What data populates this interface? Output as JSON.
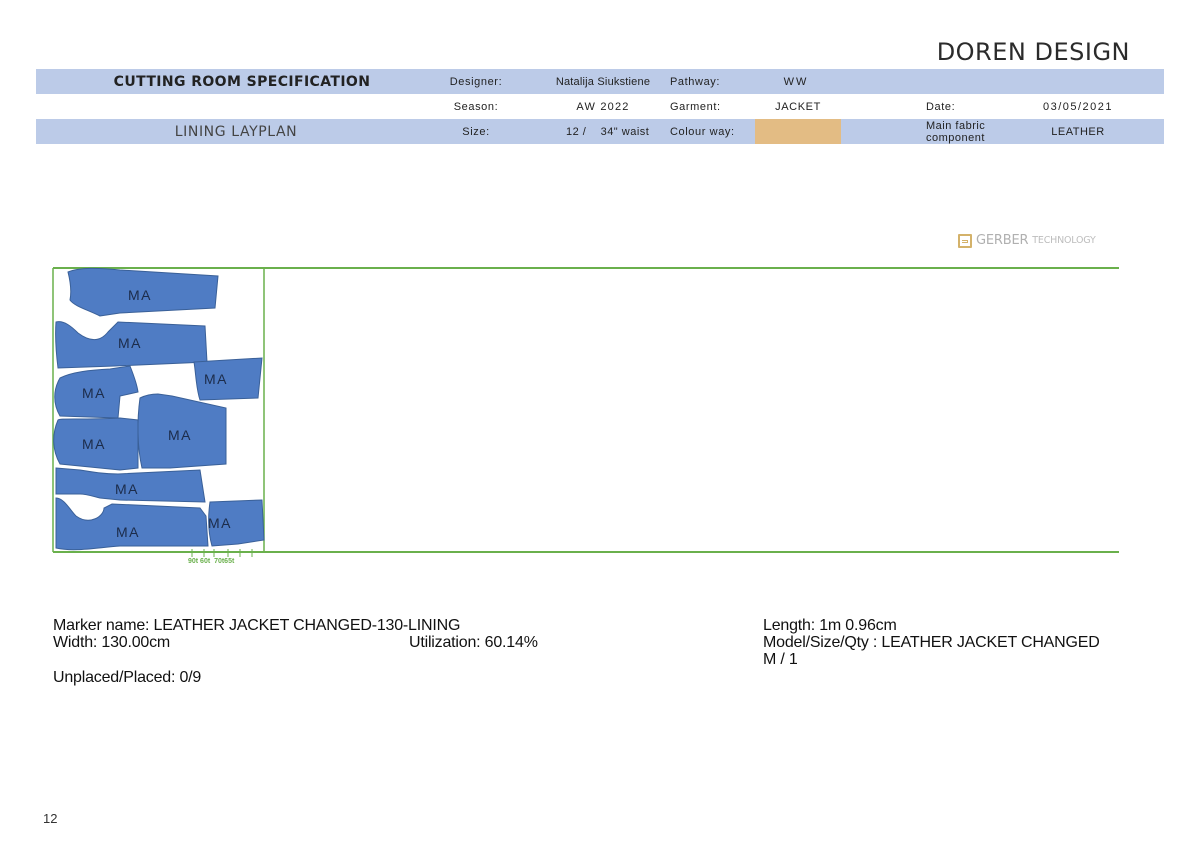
{
  "brand": "DOREN DESIGN",
  "spec": {
    "title": "CUTTING ROOM SPECIFICATION",
    "subtitle": "LINING LAYPLAN",
    "designer_label": "Designer:",
    "designer_value": "Natalija Siukstiene",
    "pathway_label": "Pathway:",
    "pathway_value": "WW",
    "season_label": "Season:",
    "season_value": "AW 2022",
    "garment_label": "Garment:",
    "garment_value": "JACKET",
    "date_label": "Date:",
    "date_value": "03/05/2021",
    "size_label": "Size:",
    "size_value": "12 /    34\" waist",
    "colour_label": "Colour way:",
    "colour_swatch": "#e3bc84",
    "main_fabric_label_line1": "Main fabric",
    "main_fabric_label_line2": "component",
    "main_fabric_value": "LEATHER"
  },
  "colors": {
    "header_band": "#bccbe8",
    "piece_fill": "#4f7cc4",
    "marker_border": "#6ab04c"
  },
  "logo": {
    "icon": "gerber-logo-icon",
    "name": "GERBER",
    "tagline": "TECHNOLOGY"
  },
  "marker": {
    "piece_labels": [
      "MA",
      "MA",
      "MA",
      "MA",
      "MA",
      "MA",
      "MA",
      "MA",
      "MA"
    ],
    "ruler_text": "90t 60t  70t65t"
  },
  "info": {
    "marker_name": "Marker name: LEATHER JACKET CHANGED-130-LINING",
    "width": "Width: 130.00cm",
    "utilization": "Utilization: 60.14%",
    "unplaced": "Unplaced/Placed: 0/9",
    "length": "Length: 1m 0.96cm",
    "model_line1": "Model/Size/Qty : LEATHER JACKET CHANGED",
    "model_line2": "M / 1"
  },
  "page_number": "12"
}
